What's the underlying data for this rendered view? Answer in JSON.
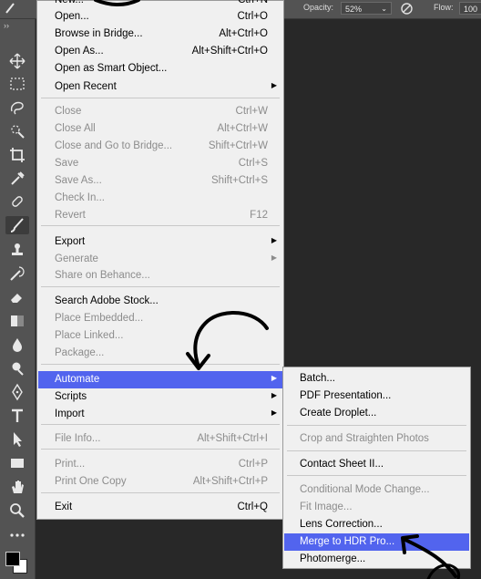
{
  "options_bar": {
    "opacity_label": "Opacity:",
    "opacity_value": "52%",
    "flow_label": "Flow:",
    "flow_value": "100"
  },
  "toolbar_expand": "››",
  "file_menu": {
    "items": [
      {
        "label": "New...",
        "shortcut": "Ctrl+N",
        "disabled": false
      },
      {
        "label": "Open...",
        "shortcut": "Ctrl+O",
        "disabled": false
      },
      {
        "label": "Browse in Bridge...",
        "shortcut": "Alt+Ctrl+O",
        "disabled": false
      },
      {
        "label": "Open As...",
        "shortcut": "Alt+Shift+Ctrl+O",
        "disabled": false
      },
      {
        "label": "Open as Smart Object...",
        "shortcut": "",
        "disabled": false
      },
      {
        "label": "Open Recent",
        "shortcut": "",
        "submenu": true,
        "disabled": false
      },
      {
        "label": "Close",
        "shortcut": "Ctrl+W",
        "disabled": true
      },
      {
        "label": "Close All",
        "shortcut": "Alt+Ctrl+W",
        "disabled": true
      },
      {
        "label": "Close and Go to Bridge...",
        "shortcut": "Shift+Ctrl+W",
        "disabled": true
      },
      {
        "label": "Save",
        "shortcut": "Ctrl+S",
        "disabled": true
      },
      {
        "label": "Save As...",
        "shortcut": "Shift+Ctrl+S",
        "disabled": true
      },
      {
        "label": "Check In...",
        "shortcut": "",
        "disabled": true
      },
      {
        "label": "Revert",
        "shortcut": "F12",
        "disabled": true
      },
      {
        "label": "Export",
        "shortcut": "",
        "submenu": true,
        "disabled": false
      },
      {
        "label": "Generate",
        "shortcut": "",
        "submenu": true,
        "disabled": true
      },
      {
        "label": "Share on Behance...",
        "shortcut": "",
        "disabled": true
      },
      {
        "label": "Search Adobe Stock...",
        "shortcut": "",
        "disabled": false
      },
      {
        "label": "Place Embedded...",
        "shortcut": "",
        "disabled": true
      },
      {
        "label": "Place Linked...",
        "shortcut": "",
        "disabled": true
      },
      {
        "label": "Package...",
        "shortcut": "",
        "disabled": true
      },
      {
        "label": "Automate",
        "shortcut": "",
        "submenu": true,
        "disabled": false,
        "highlighted": true
      },
      {
        "label": "Scripts",
        "shortcut": "",
        "submenu": true,
        "disabled": false
      },
      {
        "label": "Import",
        "shortcut": "",
        "submenu": true,
        "disabled": false
      },
      {
        "label": "File Info...",
        "shortcut": "Alt+Shift+Ctrl+I",
        "disabled": true
      },
      {
        "label": "Print...",
        "shortcut": "Ctrl+P",
        "disabled": true
      },
      {
        "label": "Print One Copy",
        "shortcut": "Alt+Shift+Ctrl+P",
        "disabled": true
      },
      {
        "label": "Exit",
        "shortcut": "Ctrl+Q",
        "disabled": false
      }
    ]
  },
  "automate_submenu": {
    "items": [
      {
        "label": "Batch...",
        "disabled": false
      },
      {
        "label": "PDF Presentation...",
        "disabled": false
      },
      {
        "label": "Create Droplet...",
        "disabled": false
      },
      {
        "label": "Crop and Straighten Photos",
        "disabled": true
      },
      {
        "label": "Contact Sheet II...",
        "disabled": false
      },
      {
        "label": "Conditional Mode Change...",
        "disabled": true
      },
      {
        "label": "Fit Image...",
        "disabled": true
      },
      {
        "label": "Lens Correction...",
        "disabled": false
      },
      {
        "label": "Merge to HDR Pro...",
        "disabled": false,
        "highlighted": true
      },
      {
        "label": "Photomerge...",
        "disabled": false
      }
    ]
  },
  "colors": {
    "menu_bg": "#f0f0f0",
    "highlight": "#5264ee",
    "toolbar_bg": "#535353",
    "workspace_bg": "#282828"
  },
  "tools": [
    "move-icon",
    "marquee-icon",
    "lasso-icon",
    "quick-select-icon",
    "crop-icon",
    "eyedropper-icon",
    "healing-brush-icon",
    "brush-icon",
    "stamp-icon",
    "history-brush-icon",
    "eraser-icon",
    "gradient-icon",
    "blur-icon",
    "dodge-icon",
    "pen-icon",
    "type-icon",
    "path-select-icon",
    "rectangle-icon",
    "hand-icon",
    "zoom-icon",
    "more-tools-icon"
  ]
}
